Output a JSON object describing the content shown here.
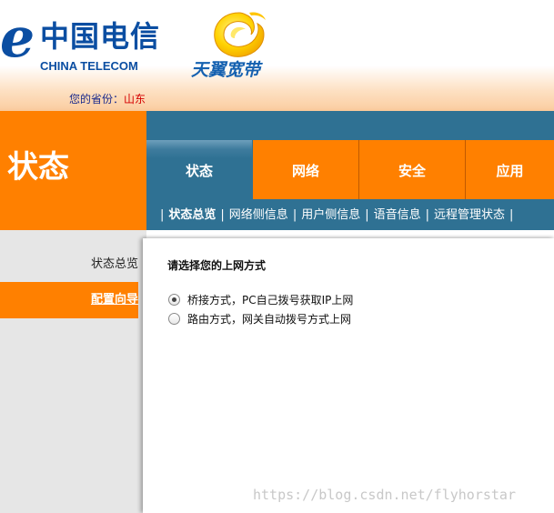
{
  "brand": {
    "ct_symbol": "e",
    "ct_cn": "中国电信",
    "ct_en": "CHINA TELECOM",
    "tianyi": "天翼宽带"
  },
  "province": {
    "label": "您的省份：",
    "value": "山东"
  },
  "section_title": "状态",
  "tabs": [
    {
      "label": "状态",
      "active": true
    },
    {
      "label": "网络"
    },
    {
      "label": "安全"
    },
    {
      "label": "应用"
    }
  ],
  "subnav": [
    {
      "label": "状态总览",
      "current": true
    },
    {
      "label": "网络侧信息"
    },
    {
      "label": "用户侧信息"
    },
    {
      "label": "语音信息"
    },
    {
      "label": "远程管理状态"
    }
  ],
  "sidebar": [
    {
      "label": "状态总览"
    },
    {
      "label": "配置向导",
      "current": true
    }
  ],
  "content": {
    "prompt": "请选择您的上网方式",
    "options": [
      {
        "label": "桥接方式，PC自己拨号获取IP上网",
        "checked": true
      },
      {
        "label": "路由方式，网关自动拨号方式上网",
        "checked": false
      }
    ]
  },
  "watermark": "https://blog.csdn.net/flyhorstar",
  "colors": {
    "orange": "#ff8000",
    "blue_nav": "#2f7193",
    "telecom_blue": "#0b4ea2"
  },
  "icons": {
    "tianyi_mark": "yellow-swirl-logo"
  }
}
